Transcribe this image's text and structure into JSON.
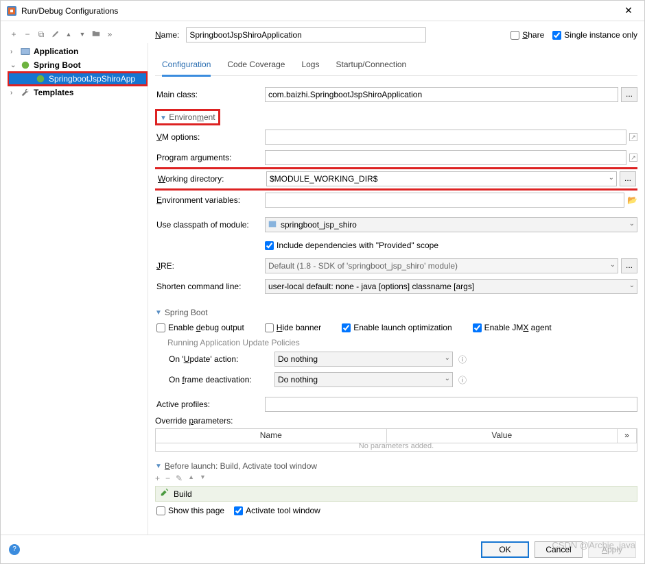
{
  "window": {
    "title": "Run/Debug Configurations"
  },
  "toolbar": {
    "add": "+",
    "remove": "−",
    "copy": "⧉",
    "wrench": "🔧",
    "up": "▲",
    "down": "▼",
    "folder": "📁",
    "more": "»"
  },
  "tree": {
    "application": "Application",
    "spring_boot": "Spring Boot",
    "selected": "SpringbootJspShiroApp",
    "templates": "Templates"
  },
  "name": {
    "label": "Name:",
    "value": "SpringbootJspShiroApplication",
    "share": "Share",
    "single_instance": "Single instance only"
  },
  "tabs": {
    "configuration": "Configuration",
    "code_coverage": "Code Coverage",
    "logs": "Logs",
    "startup": "Startup/Connection"
  },
  "form": {
    "main_class_label": "Main class:",
    "main_class_value": "com.baizhi.SpringbootJspShiroApplication",
    "environment_hdr": "Environment",
    "vm_options_label": "VM options:",
    "program_args_label": "Program arguments:",
    "working_dir_label": "Working directory:",
    "working_dir_value": "$MODULE_WORKING_DIR$",
    "env_vars_label": "Environment variables:",
    "classpath_label": "Use classpath of module:",
    "classpath_value": "springboot_jsp_shiro",
    "include_provided": "Include dependencies with \"Provided\" scope",
    "jre_label": "JRE:",
    "jre_value": "Default (1.8 - SDK of 'springboot_jsp_shiro' module)",
    "shorten_label": "Shorten command line:",
    "shorten_value_a": "user-local default: none",
    "shorten_value_b": " - java [options] classname [args]",
    "spring_boot_hdr": "Spring Boot",
    "enable_debug": "Enable debug output",
    "hide_banner": "Hide banner",
    "enable_launch_opt": "Enable launch optimization",
    "enable_jmx": "Enable JMX agent",
    "update_policies_hdr": "Running Application Update Policies",
    "on_update_label": "On 'Update' action:",
    "on_update_value": "Do nothing",
    "on_frame_label": "On frame deactivation:",
    "on_frame_value": "Do nothing",
    "active_profiles_label": "Active profiles:",
    "override_params_label": "Override parameters:",
    "col_name": "Name",
    "col_value": "Value",
    "col_more": "»",
    "phantom": "No parameters added.",
    "before_launch_hdr": "Before launch: Build, Activate tool window",
    "build_row": "Build",
    "show_this_page": "Show this page",
    "activate_tool": "Activate tool window"
  },
  "footer": {
    "ok": "OK",
    "cancel": "Cancel",
    "apply": "Apply"
  },
  "watermark": "CSDN @Archie_java"
}
